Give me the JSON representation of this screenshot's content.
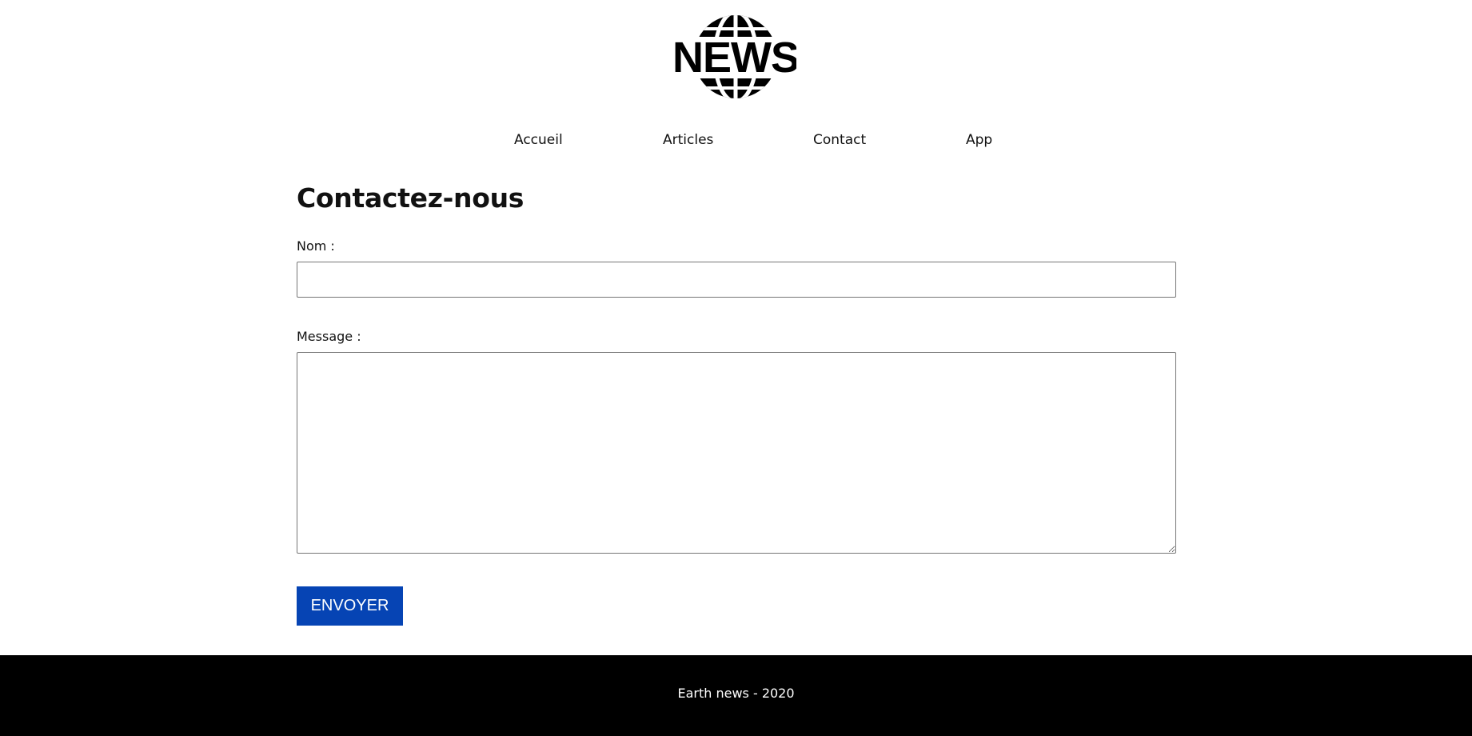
{
  "header": {
    "logo_text": "NEWS",
    "logo_icon": "globe-icon"
  },
  "nav": {
    "items": [
      {
        "label": "Accueil"
      },
      {
        "label": "Articles"
      },
      {
        "label": "Contact"
      },
      {
        "label": "App"
      }
    ]
  },
  "contact": {
    "title": "Contactez-nous",
    "name_label": "Nom :",
    "name_value": "",
    "message_label": "Message :",
    "message_value": "",
    "submit_label": "ENVOYER"
  },
  "footer": {
    "text": "Earth news - 2020"
  },
  "colors": {
    "accent": "#0644b4",
    "footer_bg": "#000000",
    "text": "#111111"
  }
}
